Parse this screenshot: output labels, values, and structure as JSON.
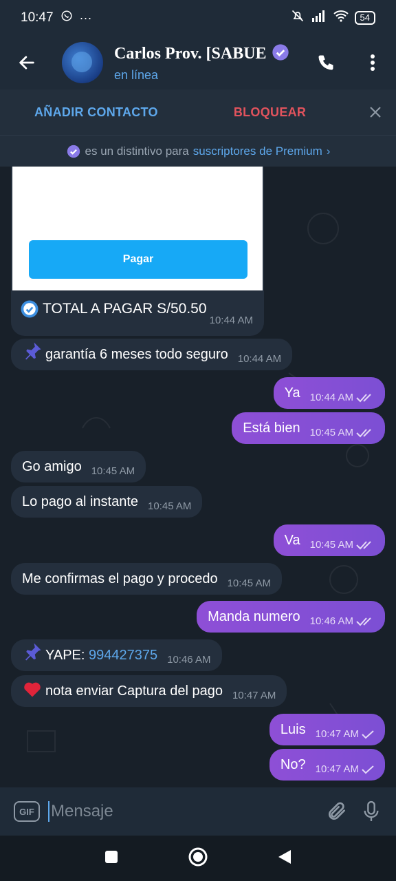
{
  "status_bar": {
    "time": "10:47",
    "battery": "54"
  },
  "header": {
    "title": "Carlos Prov. [SABUE",
    "subtitle": "en línea"
  },
  "actions": {
    "add_contact": "AÑADIR CONTACTO",
    "block": "BLOQUEAR"
  },
  "premium_notice": {
    "text": "es un distintivo para",
    "link": "suscriptores de Premium",
    "chevron": "›"
  },
  "card": {
    "button_label": "Pagar",
    "total": "TOTAL A PAGAR S/50.50",
    "time": "10:44 AM"
  },
  "messages": [
    {
      "dir": "in",
      "text": "garantía 6 meses todo seguro",
      "time": "10:44 AM",
      "icon": "pushpin-icon"
    },
    {
      "dir": "out",
      "text": "Ya",
      "time": "10:44 AM",
      "status": "read"
    },
    {
      "dir": "out",
      "text": "Está bien",
      "time": "10:45 AM",
      "status": "read"
    },
    {
      "dir": "in",
      "text": "Go amigo",
      "time": "10:45 AM"
    },
    {
      "dir": "in",
      "text": "Lo pago al instante",
      "time": "10:45 AM"
    },
    {
      "dir": "out",
      "text": "Va",
      "time": "10:45 AM",
      "status": "read"
    },
    {
      "dir": "in",
      "text": "Me confirmas el pago y procedo",
      "time": "10:45 AM"
    },
    {
      "dir": "out",
      "text": "Manda numero",
      "time": "10:46 AM",
      "status": "read"
    },
    {
      "dir": "in",
      "text": "YAPE:",
      "link": "994427375",
      "time": "10:46 AM",
      "icon": "pushpin-icon"
    },
    {
      "dir": "in",
      "text": "nota enviar Captura del pago",
      "time": "10:47 AM",
      "icon": "heart-icon"
    },
    {
      "dir": "out",
      "text": "Luis",
      "time": "10:47 AM",
      "status": "sent"
    },
    {
      "dir": "out",
      "text": "No?",
      "time": "10:47 AM",
      "status": "sent"
    }
  ],
  "input": {
    "placeholder": "Mensaje",
    "gif_label": "GIF"
  },
  "colors": {
    "accent": "#5ea8ec",
    "outgoing": "#8e4fd6",
    "danger": "#e2535d",
    "pay_button": "#17a9f6"
  }
}
